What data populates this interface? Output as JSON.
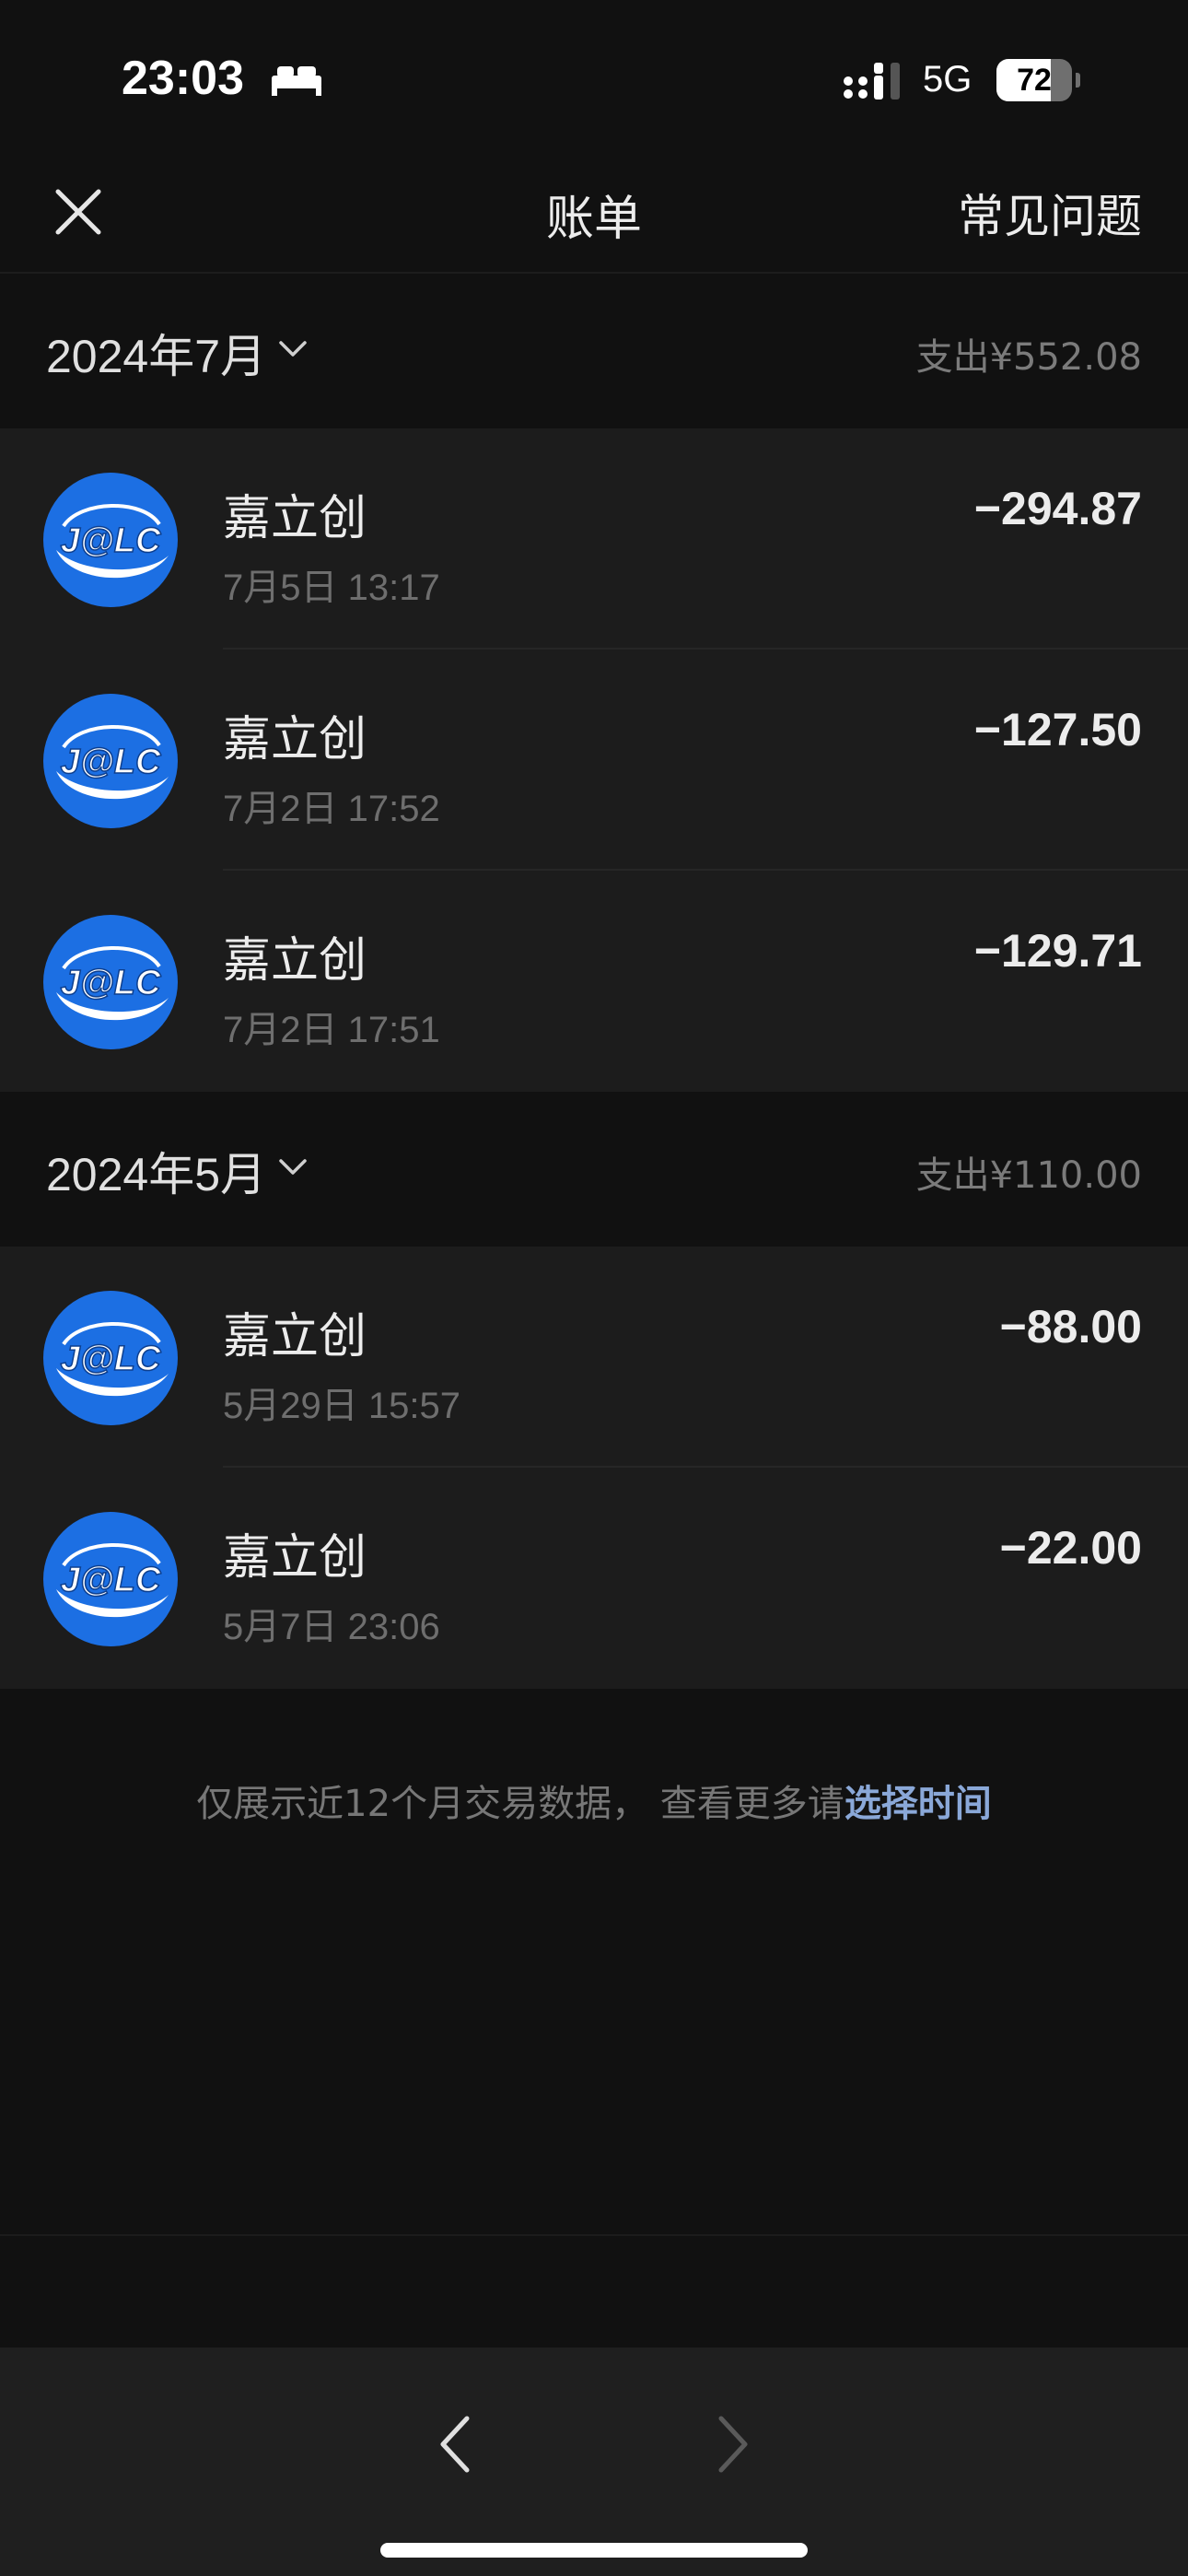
{
  "status_bar": {
    "time": "23:03",
    "network": "5G",
    "battery": "72",
    "battery_level": 0.72
  },
  "nav": {
    "title": "账单",
    "faq": "常见问题"
  },
  "months": [
    {
      "label": "2024年7月",
      "expense": "支出¥552.08",
      "transactions": [
        {
          "merchant": "嘉立创",
          "time": "7月5日 13:17",
          "amount": "−294.87"
        },
        {
          "merchant": "嘉立创",
          "time": "7月2日 17:52",
          "amount": "−127.50"
        },
        {
          "merchant": "嘉立创",
          "time": "7月2日 17:51",
          "amount": "−129.71"
        }
      ]
    },
    {
      "label": "2024年5月",
      "expense": "支出¥110.00",
      "transactions": [
        {
          "merchant": "嘉立创",
          "time": "5月29日 15:57",
          "amount": "−88.00"
        },
        {
          "merchant": "嘉立创",
          "time": "5月7日 23:06",
          "amount": "−22.00"
        }
      ]
    }
  ],
  "merchant_logo_text": "J@LC",
  "footer": {
    "note": "仅展示近12个月交易数据， 查看更多请",
    "link": "选择时间"
  },
  "colors": {
    "background": "#111111",
    "list_background": "#1c1c1c",
    "logo_blue": "#1c6fe3",
    "link": "#8aa8d8"
  },
  "icons": {
    "close": "close-icon",
    "chevron": "chevron-down-icon",
    "back": "chevron-left-icon",
    "forward": "chevron-right-icon",
    "sleep": "bed-icon",
    "signal": "cellular-signal-icon"
  }
}
